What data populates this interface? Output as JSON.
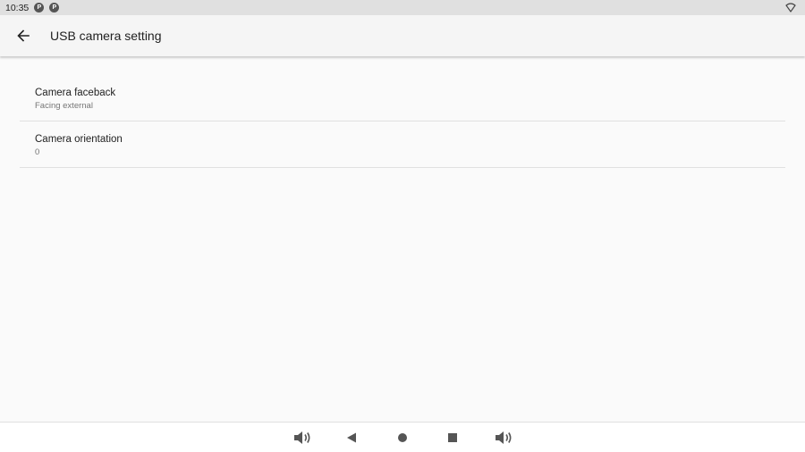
{
  "status_bar": {
    "time": "10:35",
    "notification_icons": [
      "app-notification-icon",
      "app-notification-icon"
    ],
    "notification_glyph": "P",
    "wifi_icon": "wifi-icon"
  },
  "app_bar": {
    "back_icon": "arrow-back-icon",
    "title": "USB camera setting"
  },
  "preferences": [
    {
      "title": "Camera faceback",
      "summary": "Facing external"
    },
    {
      "title": "Camera orientation",
      "summary": "0"
    }
  ],
  "nav_bar": {
    "buttons": [
      "volume-down-icon",
      "back-icon",
      "home-icon",
      "recents-icon",
      "volume-up-icon"
    ]
  },
  "colors": {
    "status_bar_bg": "#e0e0e0",
    "app_bar_bg": "#f5f5f5",
    "page_bg": "#fafafa",
    "divider": "#e0e0e0",
    "primary_text": "#212121",
    "secondary_text": "#757575",
    "nav_icon": "#555555"
  }
}
